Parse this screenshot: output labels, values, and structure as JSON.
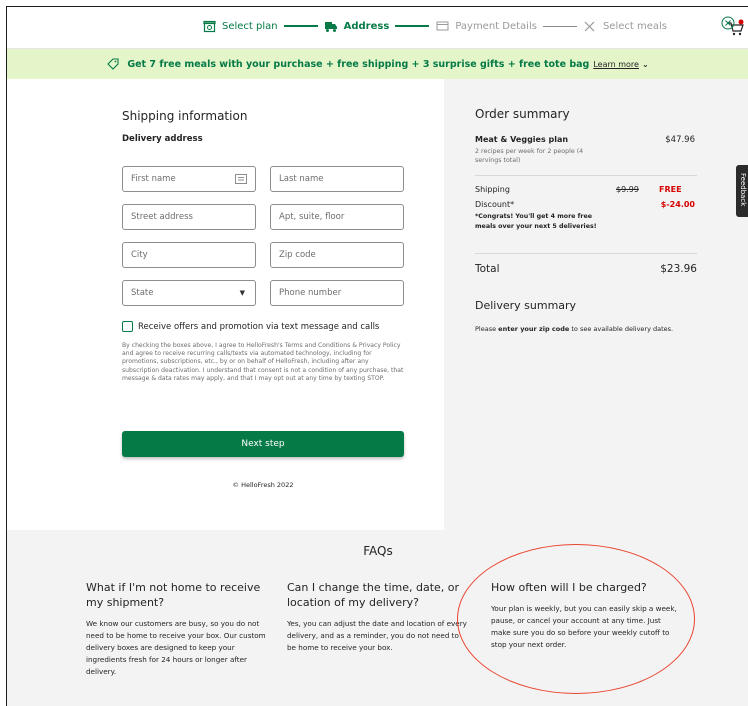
{
  "nav": {
    "steps": [
      {
        "label": "Select plan",
        "state": "done",
        "icon": "box-icon"
      },
      {
        "label": "Address",
        "state": "active",
        "icon": "truck-icon"
      },
      {
        "label": "Payment Details",
        "state": "pending",
        "icon": "card-icon"
      },
      {
        "label": "Select meals",
        "state": "pending",
        "icon": "utensils-icon"
      }
    ],
    "cart_icon": "cart-icon"
  },
  "promo": {
    "text": "Get 7 free meals with your purchase + free shipping + 3 surprise gifts + free tote bag",
    "link": "Learn more",
    "tag_icon": "tag-icon",
    "close_icon": "close-circle-icon"
  },
  "shipping": {
    "title": "Shipping information",
    "delivery_label": "Delivery address",
    "fields": {
      "first_name": "First name",
      "last_name": "Last name",
      "street": "Street address",
      "apt": "Apt, suite, floor",
      "city": "City",
      "zip": "Zip code",
      "state": "State",
      "phone": "Phone number"
    },
    "optin": "Receive offers and promotion via text message and calls",
    "legal": "By checking the boxes above, I agree to HelloFresh's Terms and Conditions & Privacy Policy and agree to receive recurring calls/texts via automated technology, including for promotions, subscriptions, etc., by or on behalf of HelloFresh, including after any subscription deactivation. I understand that consent is not a condition of any purchase, that message & data rates may apply, and that I may opt out at any time by texting STOP.",
    "next_button": "Next step",
    "copyright": "© HelloFresh 2022"
  },
  "order": {
    "title": "Order summary",
    "plan_name": "Meat & Veggies plan",
    "plan_price": "$47.96",
    "plan_desc": "2 recipes per week for 2 people (4 servings total)",
    "shipping_label": "Shipping",
    "shipping_old": "$9.99",
    "shipping_new": "FREE",
    "discount_label": "Discount*",
    "discount_value": "$-24.00",
    "congrats": "*Congrats! You'll get 4 more free meals over your next 5 deliveries!",
    "total_label": "Total",
    "total_value": "$23.96",
    "delivery_title": "Delivery summary",
    "delivery_text_pre": "Please ",
    "delivery_text_bold": "enter your zip code",
    "delivery_text_post": " to see available delivery dates.",
    "feedback": "Feedback"
  },
  "faq": {
    "title": "FAQs",
    "items": [
      {
        "q": "What if I'm not home to receive my shipment?",
        "a": "We know our customers are busy, so you do not need to be home to receive your box. Our custom delivery boxes are designed to keep your ingredients fresh for 24 hours or longer after delivery."
      },
      {
        "q": "Can I change the time, date, or location of my delivery?",
        "a": "Yes, you can adjust the date and location of every delivery, and as a reminder, you do not need to be home to receive your box."
      },
      {
        "q": "How often will I be charged?",
        "a": "Your plan is weekly, but you can easily skip a week, pause, or cancel your account at any time. Just make sure you do so before your weekly cutoff to stop your next order."
      }
    ]
  },
  "colors": {
    "brand_green": "#067a46",
    "promo_bg": "#e4f5c9",
    "alert_red": "#d50000",
    "annotation": "#e84530"
  }
}
